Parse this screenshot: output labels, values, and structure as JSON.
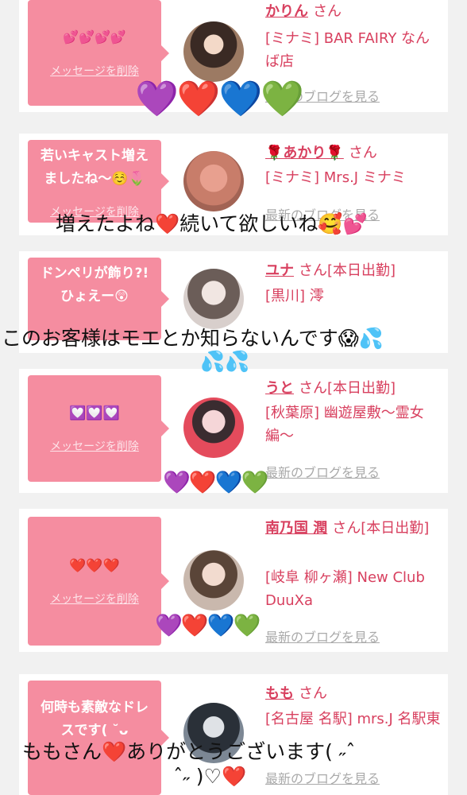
{
  "delete_label": "メッセージを削除",
  "blog_label": "最新のブログを見る",
  "san": "さん",
  "cards": [
    {
      "bubble": "💕💕💕💕",
      "name": "かりん",
      "status": "",
      "shop": "[ミナミ] BAR FAIRY なんば店"
    },
    {
      "bubble": "若いキャスト増えましたね〜☺️🌷",
      "name": "🌹あかり🌹",
      "status": "",
      "shop": "[ミナミ] Mrs.J ミナミ"
    },
    {
      "bubble": "ドンペリが飾り?!ひょえー😲",
      "name": "ユナ",
      "status": "[本日出勤]",
      "shop": "[黒川] 澪"
    },
    {
      "bubble": "💟💟💟",
      "name": "うと",
      "status": "[本日出勤]",
      "shop": "[秋葉原] 幽遊屋敷〜霊女編〜"
    },
    {
      "bubble": "❤️❤️❤️",
      "name": "南乃国 潤",
      "status": "[本日出勤]",
      "shop": "[岐阜 柳ヶ瀬] New Club DuuXa"
    },
    {
      "bubble": "何時も素敵なドレスです( ˘ᴗ",
      "name": "もも",
      "status": "",
      "shop": "[名古屋 名駅] mrs.J 名駅東"
    }
  ],
  "overlays": {
    "hearts_top": "💜❤️💙💚",
    "text_2": "増えたよね❤️続いて欲しいね🥰💕",
    "text_3": "このお客様はモエとか知らないんです😱💦",
    "text_3b": "💦💦",
    "hearts_4": "💜❤️💙💚",
    "hearts_5": "💜❤️💙💚",
    "text_6a": "ももさん❤️ありがとうございます( ˶ˆ",
    "text_6b": "ˆ˶ )♡❤️"
  }
}
